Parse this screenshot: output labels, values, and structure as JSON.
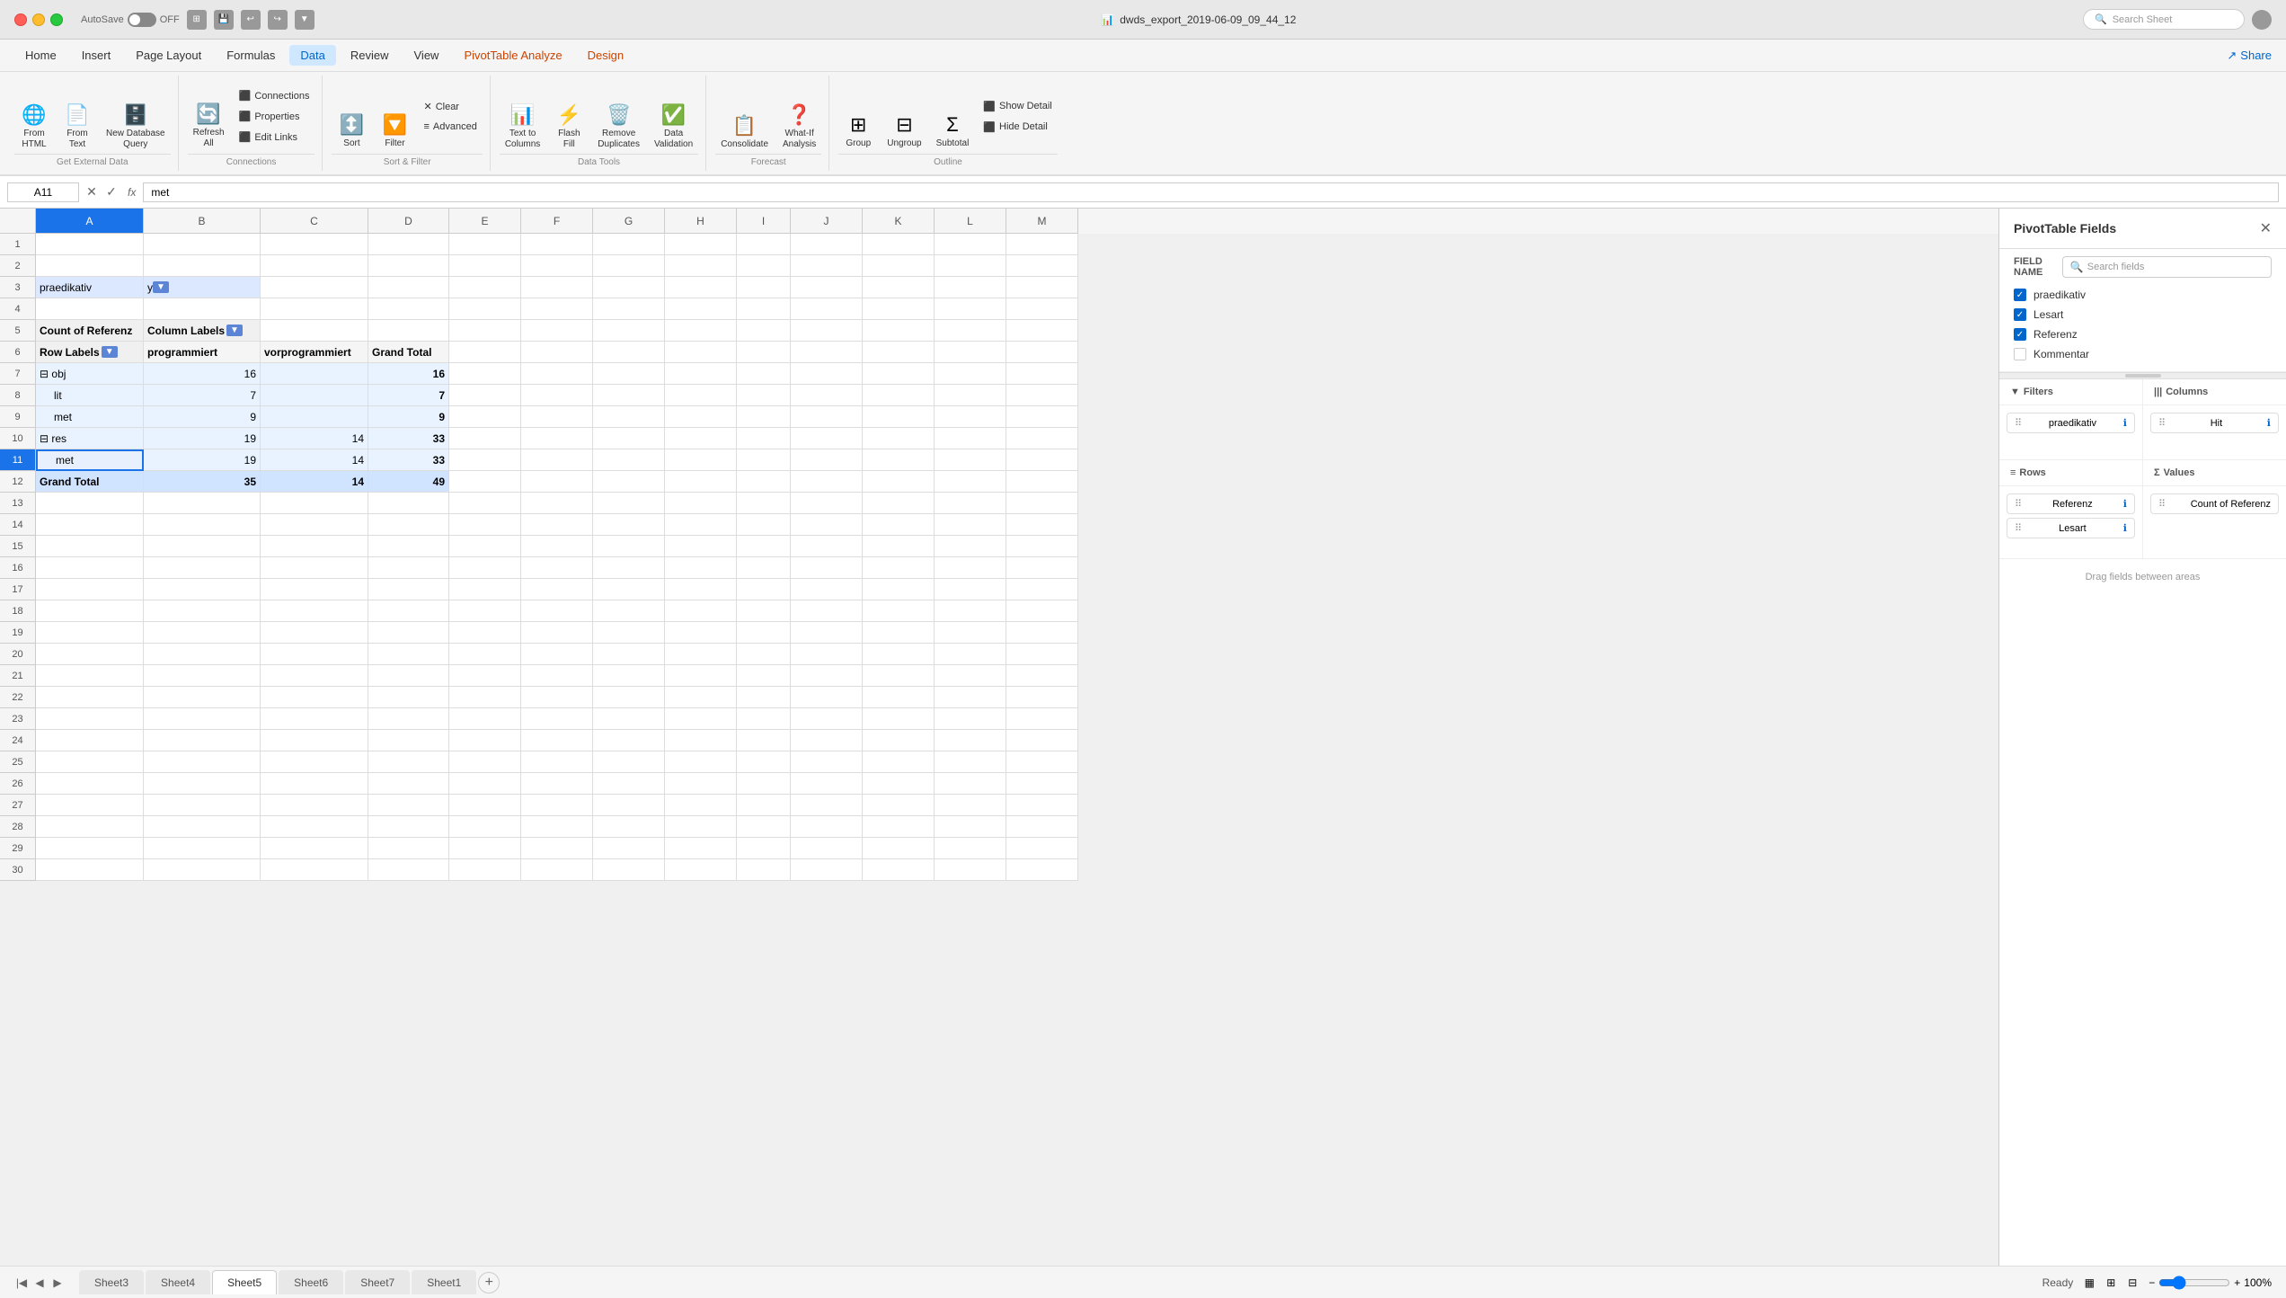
{
  "titleBar": {
    "autosave": "AutoSave",
    "autosave_off": "OFF",
    "filename": "dwds_export_2019-06-09_09_44_12",
    "search_placeholder": "Search Sheet"
  },
  "menuBar": {
    "items": [
      {
        "label": "Home",
        "active": false
      },
      {
        "label": "Insert",
        "active": false
      },
      {
        "label": "Page Layout",
        "active": false
      },
      {
        "label": "Formulas",
        "active": false
      },
      {
        "label": "Data",
        "active": true
      },
      {
        "label": "Review",
        "active": false
      },
      {
        "label": "View",
        "active": false
      },
      {
        "label": "PivotTable Analyze",
        "active": false,
        "special": "pivot"
      },
      {
        "label": "Design",
        "active": false,
        "special": "design"
      }
    ],
    "share": "Share"
  },
  "ribbon": {
    "groups": [
      {
        "label": "Get External Data",
        "items": [
          {
            "id": "from-html",
            "label": "From\nHTML",
            "icon": "🌐"
          },
          {
            "id": "from-text",
            "label": "From\nText",
            "icon": "📄"
          },
          {
            "id": "new-db-query",
            "label": "New Database\nQuery",
            "icon": "🗄️"
          }
        ]
      },
      {
        "label": "Connections",
        "items": [
          {
            "id": "refresh-all",
            "label": "Refresh All",
            "icon": "🔄"
          },
          {
            "id": "connections",
            "label": "Connections",
            "icon": "",
            "small": true
          },
          {
            "id": "properties",
            "label": "Properties",
            "icon": "",
            "small": true
          },
          {
            "id": "edit-links",
            "label": "Edit Links",
            "icon": "",
            "small": true
          }
        ]
      },
      {
        "label": "Sort & Filter",
        "items": [
          {
            "id": "sort",
            "label": "Sort",
            "icon": "↕️"
          },
          {
            "id": "filter",
            "label": "Filter",
            "icon": "🔽"
          },
          {
            "id": "clear",
            "label": "Clear",
            "icon": ""
          },
          {
            "id": "advanced",
            "label": "Advanced",
            "icon": ""
          }
        ]
      },
      {
        "label": "Data Tools",
        "items": [
          {
            "id": "text-to-columns",
            "label": "Text to\nColumns",
            "icon": "📊"
          },
          {
            "id": "flash-fill",
            "label": "Flash\nFill",
            "icon": "⚡"
          },
          {
            "id": "remove-duplicates",
            "label": "Remove\nDuplicates",
            "icon": "🗑️"
          },
          {
            "id": "data-validation",
            "label": "Data\nValidation",
            "icon": "✅"
          }
        ]
      },
      {
        "label": "Forecast",
        "items": [
          {
            "id": "consolidate",
            "label": "Consolidate",
            "icon": "📋"
          },
          {
            "id": "what-if",
            "label": "What-If\nAnalysis",
            "icon": "❓"
          }
        ]
      },
      {
        "label": "Outline",
        "items": [
          {
            "id": "group",
            "label": "Group",
            "icon": ""
          },
          {
            "id": "ungroup",
            "label": "Ungroup",
            "icon": ""
          },
          {
            "id": "subtotal",
            "label": "Subtotal",
            "icon": ""
          },
          {
            "id": "show-detail",
            "label": "Show Detail",
            "icon": ""
          },
          {
            "id": "hide-detail",
            "label": "Hide Detail",
            "icon": ""
          }
        ]
      }
    ]
  },
  "formulaBar": {
    "cellRef": "A11",
    "formula": "met"
  },
  "spreadsheet": {
    "columns": [
      "A",
      "B",
      "C",
      "D",
      "E",
      "F",
      "G",
      "H",
      "I",
      "J",
      "K",
      "L",
      "M"
    ],
    "rows": [
      {
        "row": 1,
        "cells": {
          "A": "",
          "B": "",
          "C": "",
          "D": "",
          "E": "",
          "F": "",
          "G": "",
          "H": "",
          "I": "",
          "J": "",
          "K": "",
          "L": "",
          "M": ""
        }
      },
      {
        "row": 2,
        "cells": {
          "A": "",
          "B": "",
          "C": "",
          "D": "",
          "E": "",
          "F": "",
          "G": "",
          "H": "",
          "I": "",
          "J": "",
          "K": "",
          "L": "",
          "M": ""
        }
      },
      {
        "row": 3,
        "cells": {
          "A": "praedikativ",
          "B": "y",
          "C": "",
          "D": "",
          "E": "",
          "F": "",
          "G": "",
          "H": "",
          "I": "",
          "J": "",
          "K": "",
          "L": "",
          "M": ""
        },
        "types": {
          "A": "filter-cell",
          "B": "filter-cell",
          "C": "filter-dropdown"
        }
      },
      {
        "row": 4,
        "cells": {
          "A": "",
          "B": "",
          "C": "",
          "D": "",
          "E": "",
          "F": "",
          "G": "",
          "H": "",
          "I": "",
          "J": "",
          "K": "",
          "L": "",
          "M": ""
        }
      },
      {
        "row": 5,
        "cells": {
          "A": "Count of Referenz",
          "B": "Column Labels",
          "C": "",
          "D": "",
          "E": "",
          "F": "",
          "G": "",
          "H": "",
          "I": "",
          "J": "",
          "K": "",
          "L": "",
          "M": ""
        },
        "types": {
          "A": "pivot-header",
          "B": "pivot-header"
        }
      },
      {
        "row": 6,
        "cells": {
          "A": "Row Labels",
          "B": "programmiert",
          "C": "vorprogrammiert",
          "D": "Grand Total",
          "E": "",
          "F": "",
          "G": "",
          "H": "",
          "I": "",
          "J": "",
          "K": "",
          "L": "",
          "M": ""
        },
        "types": {
          "A": "pivot-row-label",
          "B": "pivot-label",
          "C": "pivot-label",
          "D": "pivot-label"
        }
      },
      {
        "row": 7,
        "cells": {
          "A": "⊟ obj",
          "B": "16",
          "C": "",
          "D": "16",
          "E": "",
          "F": "",
          "G": "",
          "H": "",
          "I": "",
          "J": "",
          "K": "",
          "L": "",
          "M": ""
        },
        "types": {
          "A": "pivot-data",
          "B": "pivot-data",
          "D": "pivot-data"
        }
      },
      {
        "row": 8,
        "cells": {
          "A": "    lit",
          "B": "7",
          "C": "",
          "D": "7",
          "E": "",
          "F": "",
          "G": "",
          "H": "",
          "I": "",
          "J": "",
          "K": "",
          "L": "",
          "M": ""
        },
        "types": {
          "A": "pivot-data",
          "B": "pivot-data",
          "D": "pivot-data"
        }
      },
      {
        "row": 9,
        "cells": {
          "A": "    met",
          "B": "9",
          "C": "",
          "D": "9",
          "E": "",
          "F": "",
          "G": "",
          "H": "",
          "I": "",
          "J": "",
          "K": "",
          "L": "",
          "M": ""
        },
        "types": {
          "A": "pivot-data",
          "B": "pivot-data",
          "D": "pivot-data"
        }
      },
      {
        "row": 10,
        "cells": {
          "A": "⊟ res",
          "B": "19",
          "C": "14",
          "D": "33",
          "E": "",
          "F": "",
          "G": "",
          "H": "",
          "I": "",
          "J": "",
          "K": "",
          "L": "",
          "M": ""
        },
        "types": {
          "A": "pivot-data",
          "B": "pivot-data",
          "C": "pivot-data",
          "D": "pivot-data"
        }
      },
      {
        "row": 11,
        "cells": {
          "A": "    met",
          "B": "19",
          "C": "14",
          "D": "33",
          "E": "",
          "F": "",
          "G": "",
          "H": "",
          "I": "",
          "J": "",
          "K": "",
          "L": "",
          "M": ""
        },
        "types": {
          "A": "active",
          "B": "pivot-data",
          "C": "pivot-data",
          "D": "pivot-data"
        }
      },
      {
        "row": 12,
        "cells": {
          "A": "Grand Total",
          "B": "35",
          "C": "14",
          "D": "49",
          "E": "",
          "F": "",
          "G": "",
          "H": "",
          "I": "",
          "J": "",
          "K": "",
          "L": "",
          "M": ""
        },
        "types": {
          "A": "pivot-total",
          "B": "pivot-total",
          "C": "pivot-total",
          "D": "pivot-total"
        }
      },
      {
        "row": 13,
        "cells": {}
      },
      {
        "row": 14,
        "cells": {}
      },
      {
        "row": 15,
        "cells": {}
      },
      {
        "row": 16,
        "cells": {}
      },
      {
        "row": 17,
        "cells": {}
      },
      {
        "row": 18,
        "cells": {}
      },
      {
        "row": 19,
        "cells": {}
      },
      {
        "row": 20,
        "cells": {}
      },
      {
        "row": 21,
        "cells": {}
      },
      {
        "row": 22,
        "cells": {}
      },
      {
        "row": 23,
        "cells": {}
      },
      {
        "row": 24,
        "cells": {}
      },
      {
        "row": 25,
        "cells": {}
      },
      {
        "row": 26,
        "cells": {}
      },
      {
        "row": 27,
        "cells": {}
      },
      {
        "row": 28,
        "cells": {}
      },
      {
        "row": 29,
        "cells": {}
      },
      {
        "row": 30,
        "cells": {}
      }
    ]
  },
  "pivotPanel": {
    "title": "PivotTable Fields",
    "field_name_label": "FIELD NAME",
    "search_placeholder": "Search fields",
    "fields": [
      {
        "label": "praedikativ",
        "checked": true
      },
      {
        "label": "Lesart",
        "checked": true
      },
      {
        "label": "Referenz",
        "checked": true
      },
      {
        "label": "Kommentar",
        "checked": false
      }
    ],
    "filters_label": "Filters",
    "columns_label": "Columns",
    "filters_items": [
      {
        "label": "praedikativ"
      }
    ],
    "columns_items": [
      {
        "label": "Hit"
      }
    ],
    "rows_label": "Rows",
    "values_label": "Values",
    "rows_items": [
      {
        "label": "Referenz"
      },
      {
        "label": "Lesart"
      }
    ],
    "values_items": [
      {
        "label": "Count of Referenz"
      }
    ],
    "drag_hint": "Drag fields between areas"
  },
  "statusBar": {
    "status": "Ready",
    "sheets": [
      "Sheet3",
      "Sheet4",
      "Sheet5",
      "Sheet6",
      "Sheet7",
      "Sheet1"
    ],
    "active_sheet": "Sheet5",
    "zoom": "100%"
  }
}
